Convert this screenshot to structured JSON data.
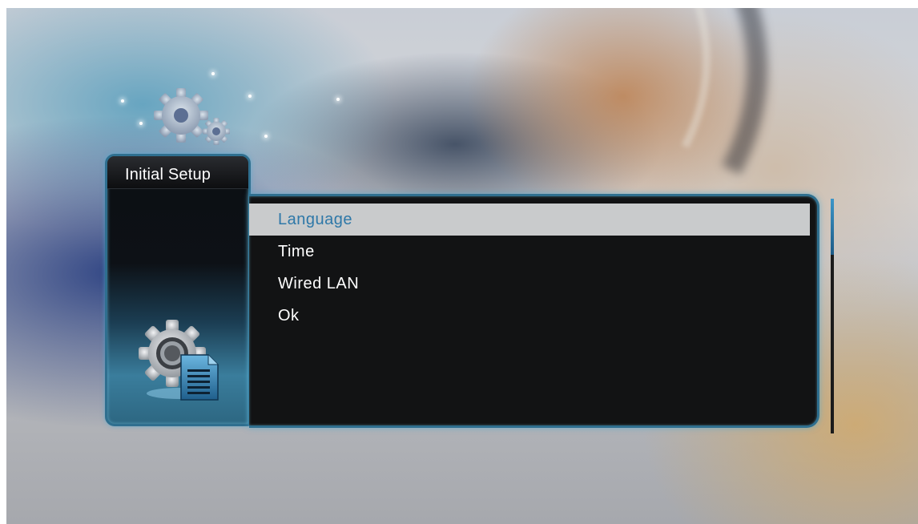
{
  "panel": {
    "title": "Initial Setup",
    "title_icon": "settings-gears-icon",
    "side_icon": "setup-gear-document-icon"
  },
  "menu": {
    "items": [
      {
        "label": "Language",
        "selected": true
      },
      {
        "label": "Time",
        "selected": false
      },
      {
        "label": "Wired LAN",
        "selected": false
      },
      {
        "label": "Ok",
        "selected": false
      }
    ]
  },
  "scrollbar": {
    "position_fraction": 0.0,
    "visible_fraction": 0.24
  },
  "colors": {
    "selected_bg": "#c9cbcc",
    "selected_text": "#2e78a8",
    "menu_text": "#ffffff",
    "frame_accent": "#2f6f8f",
    "menu_bg": "#121314"
  }
}
